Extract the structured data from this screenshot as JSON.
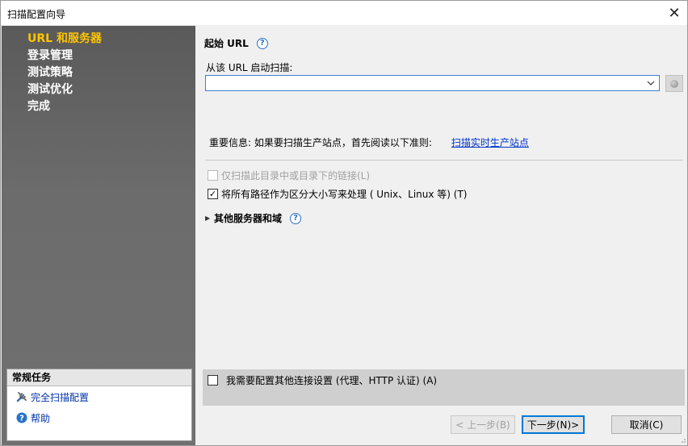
{
  "window": {
    "title": "扫描配置向导",
    "close_glyph": "✕"
  },
  "sidebar": {
    "steps": [
      {
        "label": "URL 和服务器",
        "active": true
      },
      {
        "label": "登录管理",
        "active": false
      },
      {
        "label": "测试策略",
        "active": false
      },
      {
        "label": "测试优化",
        "active": false
      },
      {
        "label": "完成",
        "active": false
      }
    ],
    "tasks": {
      "header": "常规任务",
      "items": [
        {
          "label": "完全扫描配置",
          "icon": "tools-icon"
        },
        {
          "label": "帮助",
          "icon": "help-icon"
        }
      ]
    }
  },
  "main": {
    "section_title": "起始 URL",
    "url_label": "从该 URL 启动扫描:",
    "url_value": "",
    "info_text": "重要信息: 如果要扫描生产站点，首先阅读以下准则:",
    "info_link": "扫描实时生产站点",
    "options": [
      {
        "label": "仅扫描此目录中或目录下的链接(L)",
        "checked": false,
        "disabled": true
      },
      {
        "label": "将所有路径作为区分大小写来处理 ( Unix、Linux 等) (T)",
        "checked": true,
        "disabled": false
      }
    ],
    "expander_label": "其他服务器和域",
    "connection_option": {
      "label": "我需要配置其他连接设置 (代理、HTTP 认证) (A)",
      "checked": false
    }
  },
  "buttons": {
    "back": "< 上一步(B)",
    "next": "下一步(N)>",
    "cancel": "取消(C)"
  },
  "colors": {
    "active_step": "#ffc400",
    "link": "#0033cc",
    "focus_border": "#0078d7"
  }
}
